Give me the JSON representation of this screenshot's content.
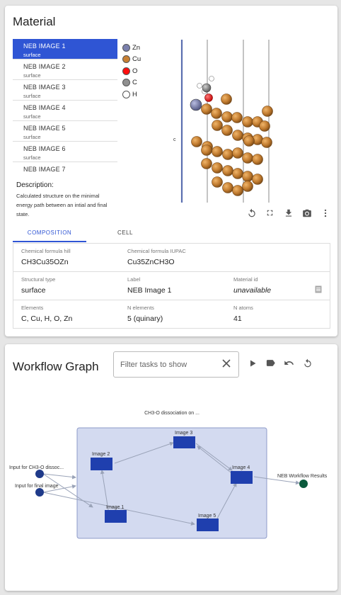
{
  "material": {
    "title": "Material",
    "list": [
      {
        "label": "NEB IMAGE 1",
        "sub": "surface"
      },
      {
        "label": "NEB IMAGE 2",
        "sub": "surface"
      },
      {
        "label": "NEB IMAGE 3",
        "sub": "surface"
      },
      {
        "label": "NEB IMAGE 4",
        "sub": "surface"
      },
      {
        "label": "NEB IMAGE 5",
        "sub": "surface"
      },
      {
        "label": "NEB IMAGE 6",
        "sub": "surface"
      },
      {
        "label": "NEB IMAGE 7",
        "sub": ""
      }
    ],
    "description_heading": "Description:",
    "description": "Calculated structure on the minimal energy path between an intial and final state.",
    "legend": [
      {
        "symbol": "Zn",
        "color": "#7b80ad"
      },
      {
        "symbol": "Cu",
        "color": "#c88033"
      },
      {
        "symbol": "O",
        "color": "#ff0d0d"
      },
      {
        "symbol": "C",
        "color": "#909090"
      },
      {
        "symbol": "H",
        "color": "#ffffff"
      }
    ],
    "axis_label": "c",
    "tabs": [
      "COMPOSITION",
      "CELL"
    ],
    "fields": {
      "formula_hill_label": "Chemical formula hill",
      "formula_hill": "CH3Cu35OZn",
      "formula_iupac_label": "Chemical formula IUPAC",
      "formula_iupac": "Cu35ZnCH3O",
      "structural_type_label": "Structural type",
      "structural_type": "surface",
      "label_label": "Label",
      "label": "NEB Image 1",
      "material_id_label": "Material id",
      "material_id": "unavailable",
      "elements_label": "Elements",
      "elements": "C, Cu, H, O, Zn",
      "n_elements_label": "N elements",
      "n_elements": "5 (quinary)",
      "n_atoms_label": "N atoms",
      "n_atoms": "41"
    },
    "colors": {
      "accent": "#2f55d4",
      "cell_line": "#5b6fb0"
    }
  },
  "workflow": {
    "title": "Workflow Graph",
    "filter_placeholder": "Filter tasks to show",
    "group_title": "CH3-O dissociation on ...",
    "nodes": {
      "input1": "Input for CH3-O dissoc...",
      "input2": "Input for final image",
      "image1": "Image 1",
      "image2": "Image 2",
      "image3": "Image 3",
      "image4": "Image 4",
      "image5": "Image 5",
      "result": "NEB Workflow Results"
    },
    "colors": {
      "task": "#1f3fae",
      "input": "#1f3a8a",
      "result": "#0b5a3c",
      "group_fill": "#d3daf0",
      "group_stroke": "#8e9bc9"
    }
  }
}
